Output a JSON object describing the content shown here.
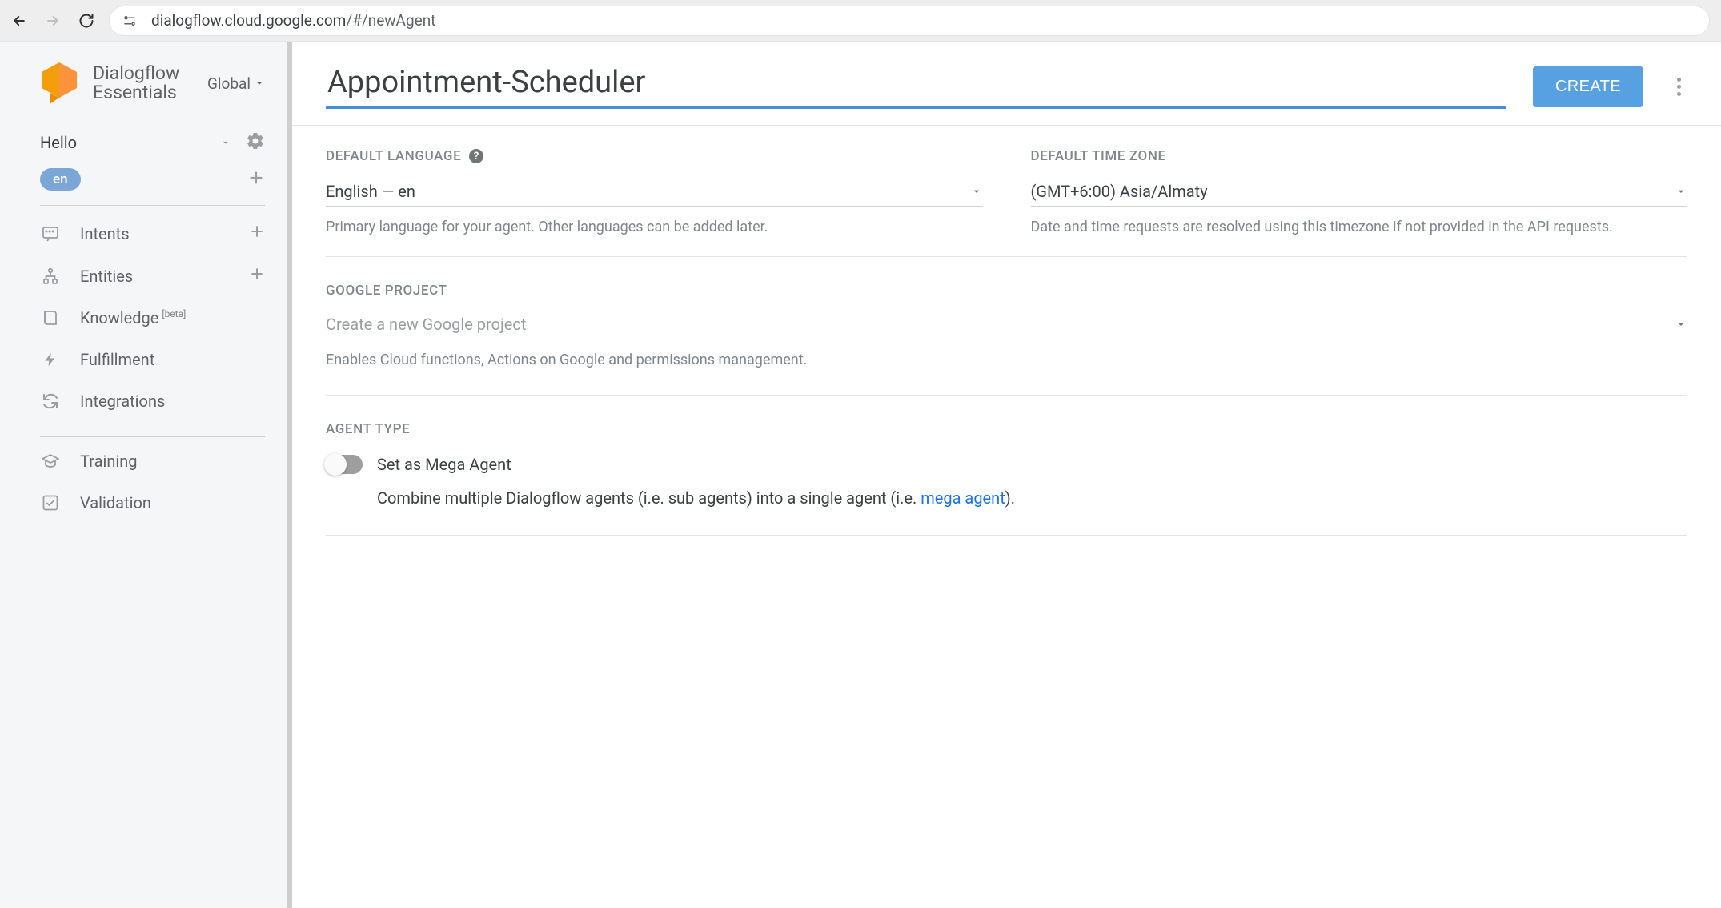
{
  "browser": {
    "url_host": "dialogflow.cloud.google.com",
    "url_path": "/#/newAgent"
  },
  "brand": {
    "line1": "Dialogflow",
    "line2": "Essentials",
    "scope": "Global"
  },
  "sidebar": {
    "agent_name": "Hello",
    "language_chip": "en",
    "items": [
      {
        "icon": "intents",
        "label": "Intents",
        "trailing": "plus",
        "sup": ""
      },
      {
        "icon": "entities",
        "label": "Entities",
        "trailing": "plus",
        "sup": ""
      },
      {
        "icon": "knowledge",
        "label": "Knowledge",
        "trailing": "",
        "sup": "[beta]"
      },
      {
        "icon": "fulfillment",
        "label": "Fulfillment",
        "trailing": "",
        "sup": ""
      },
      {
        "icon": "integrations",
        "label": "Integrations",
        "trailing": "",
        "sup": ""
      },
      {
        "icon": "training",
        "label": "Training",
        "trailing": "",
        "sup": ""
      },
      {
        "icon": "validation",
        "label": "Validation",
        "trailing": "",
        "sup": ""
      }
    ]
  },
  "header": {
    "title_value": "Appointment-Scheduler",
    "create_label": "CREATE"
  },
  "sections": {
    "language": {
      "heading": "DEFAULT LANGUAGE",
      "value": "English — en",
      "helper": "Primary language for your agent. Other languages can be added later."
    },
    "timezone": {
      "heading": "DEFAULT TIME ZONE",
      "value": "(GMT+6:00) Asia/Almaty",
      "helper": "Date and time requests are resolved using this timezone if not provided in the API requests."
    },
    "project": {
      "heading": "GOOGLE PROJECT",
      "placeholder": "Create a new Google project",
      "helper": "Enables Cloud functions, Actions on Google and permissions management."
    },
    "agent_type": {
      "heading": "AGENT TYPE",
      "toggle_label": "Set as Mega Agent",
      "desc_pre": "Combine multiple Dialogflow agents (i.e. sub agents) into a single agent (i.e. ",
      "desc_link": "mega agent",
      "desc_post": ")."
    }
  }
}
